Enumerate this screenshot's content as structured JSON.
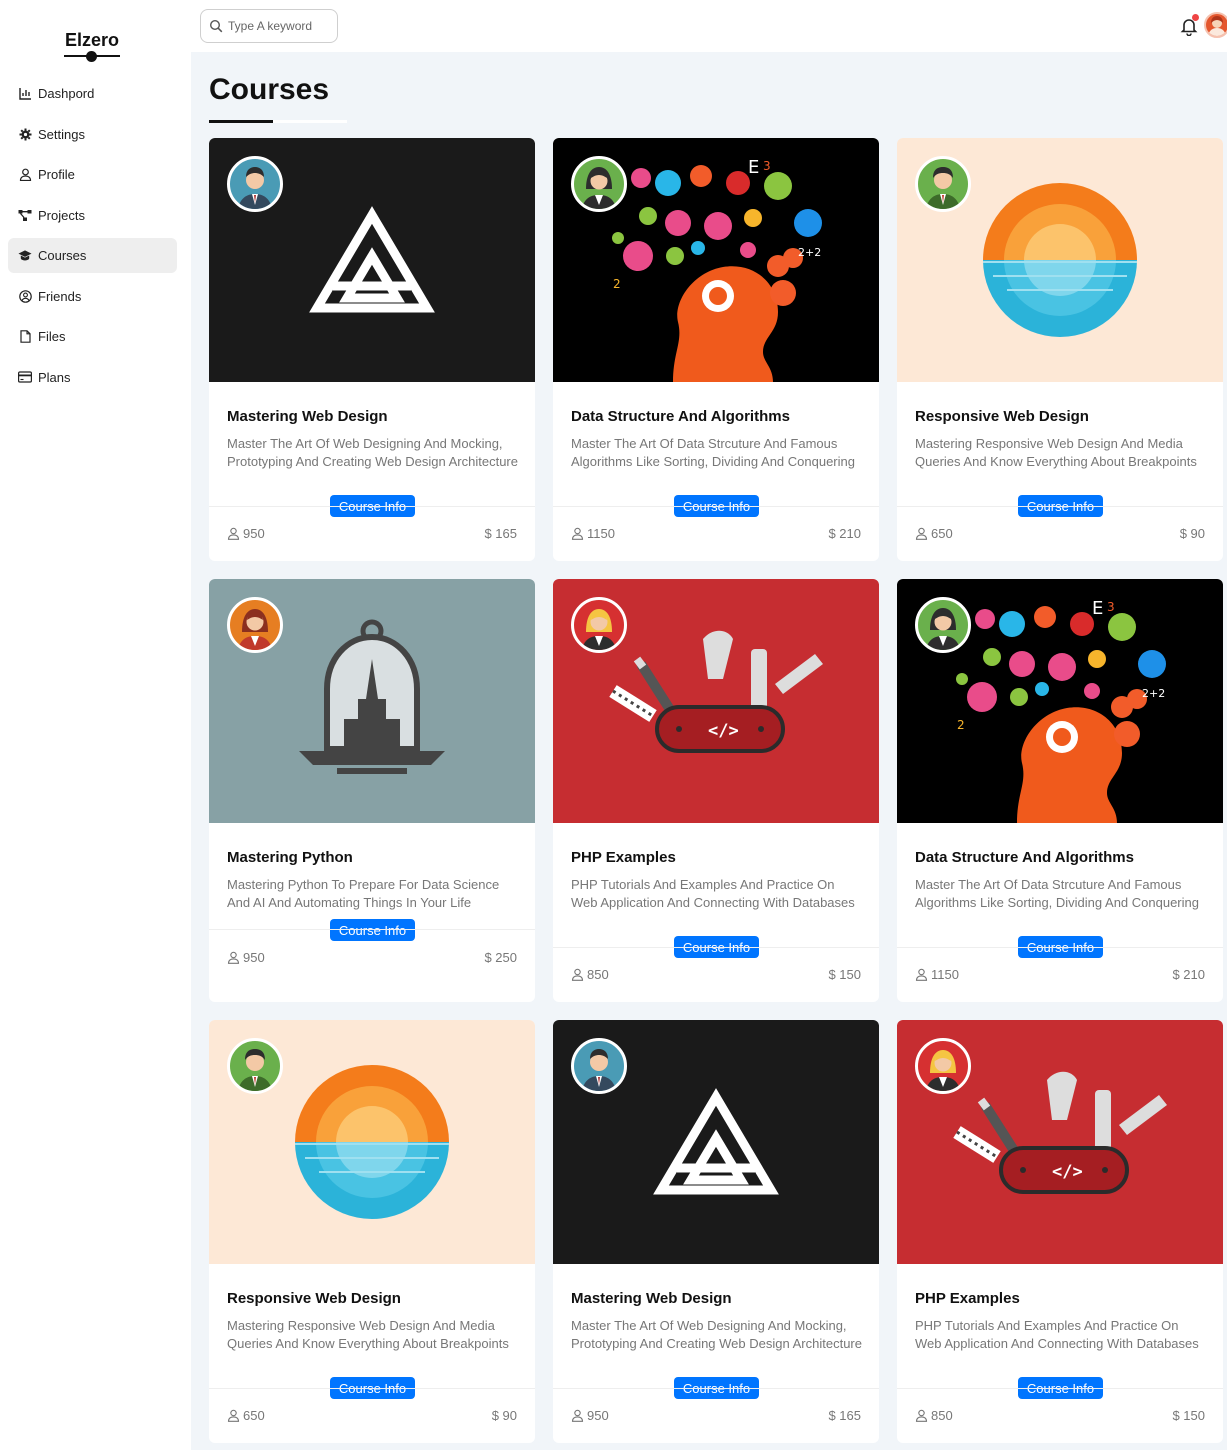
{
  "app": {
    "logo": "Elzero"
  },
  "sidebar": {
    "items": [
      {
        "label": "Dashpord",
        "icon": "chart-icon",
        "active": false
      },
      {
        "label": "Settings",
        "icon": "gear-icon",
        "active": false
      },
      {
        "label": "Profile",
        "icon": "user-icon",
        "active": false
      },
      {
        "label": "Projects",
        "icon": "diagram-project-icon",
        "active": false
      },
      {
        "label": "Courses",
        "icon": "graduation-cap-icon",
        "active": true
      },
      {
        "label": "Friends",
        "icon": "user-circle-icon",
        "active": false
      },
      {
        "label": "Files",
        "icon": "file-icon",
        "active": false
      },
      {
        "label": "Plans",
        "icon": "credit-card-icon",
        "active": false
      }
    ]
  },
  "header": {
    "search_placeholder": "Type A keyword",
    "has_notification": true
  },
  "page": {
    "title": "Courses"
  },
  "colors": {
    "accent": "#0075ff",
    "notification": "#ef4444"
  },
  "courses": [
    {
      "title": "Mastering Web Design",
      "description": "Master The Art Of Web Designing And Mocking, Prototyping And Creating Web Design Architecture",
      "button": "Course Info",
      "students": "950",
      "price": "$ 165",
      "image": "logo-a",
      "avatar": "avatar-man-blue"
    },
    {
      "title": "Data Structure And Algorithms",
      "description": "Master The Art Of Data Strcuture And Famous Algorithms Like Sorting, Dividing And Conquering",
      "button": "Course Info",
      "students": "1150",
      "price": "$ 210",
      "image": "brain-head",
      "avatar": "avatar-woman-green"
    },
    {
      "title": "Responsive Web Design",
      "description": "Mastering Responsive Web Design And Media Queries And Know Everything About Breakpoints",
      "button": "Course Info",
      "students": "650",
      "price": "$ 90",
      "image": "sunset-circle",
      "avatar": "avatar-man-green"
    },
    {
      "title": "Mastering Python",
      "description": "Mastering Python To Prepare For Data Science And AI And Automating Things In Your Life",
      "button": "Course Info",
      "students": "950",
      "price": "$ 250",
      "image": "bell-jar",
      "avatar": "avatar-woman-orange"
    },
    {
      "title": "PHP Examples",
      "description": "PHP Tutorials And Examples And Practice On Web Application And Connecting With Databases",
      "button": "Course Info",
      "students": "850",
      "price": "$ 150",
      "image": "swiss-knife",
      "avatar": "avatar-woman-red"
    },
    {
      "title": "Data Structure And Algorithms",
      "description": "Master The Art Of Data Strcuture And Famous Algorithms Like Sorting, Dividing And Conquering",
      "button": "Course Info",
      "students": "1150",
      "price": "$ 210",
      "image": "brain-head",
      "avatar": "avatar-woman-green"
    },
    {
      "title": "Responsive Web Design",
      "description": "Mastering Responsive Web Design And Media Queries And Know Everything About Breakpoints",
      "button": "Course Info",
      "students": "650",
      "price": "$ 90",
      "image": "sunset-circle",
      "avatar": "avatar-man-green"
    },
    {
      "title": "Mastering Web Design",
      "description": "Master The Art Of Web Designing And Mocking, Prototyping And Creating Web Design Architecture",
      "button": "Course Info",
      "students": "950",
      "price": "$ 165",
      "image": "logo-a",
      "avatar": "avatar-man-blue"
    },
    {
      "title": "PHP Examples",
      "description": "PHP Tutorials And Examples And Practice On Web Application And Connecting With Databases",
      "button": "Course Info",
      "students": "850",
      "price": "$ 150",
      "image": "swiss-knife",
      "avatar": "avatar-woman-red"
    }
  ]
}
